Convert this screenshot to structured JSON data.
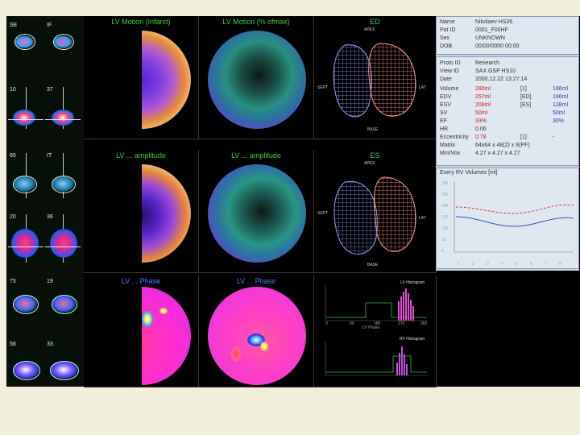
{
  "strip": {
    "labels": [
      "SE",
      "IF",
      "10",
      "37",
      "65",
      "IT",
      "20",
      "36",
      "75",
      "19",
      "56",
      "33"
    ]
  },
  "panels": {
    "lv_motion": "LV Motion (Infarct)",
    "lv_motion_rel": "LV Motion (% ofmax)",
    "mesh_top": "ED",
    "lv_amplitude": "LV ... amplitude",
    "lv_amplitude2": "LV ... amplitude",
    "mesh_bottom": "ES",
    "lv_phase": "LV ... Phase",
    "lv_phase2": "LV ... Phase",
    "hist_title_1": "LV Histogram",
    "hist_title_2": "RV Histogram",
    "mesh_labels": {
      "top": "APEX",
      "left": "SEPT",
      "right": "LAT",
      "bottom": "BASE"
    },
    "hist_axis_ticks": [
      "0",
      "90",
      "180",
      "270",
      "360"
    ],
    "hist_axis_label": "LV Phase"
  },
  "info": {
    "patient": [
      {
        "k": "Name",
        "v": "Nikolaev HS36"
      },
      {
        "k": "Pat ID",
        "v": "0001_F00HF"
      },
      {
        "k": "Sex",
        "v": "UNKNOWN"
      },
      {
        "k": "DOB",
        "v": "00/00/0000 00:00"
      }
    ],
    "study": [
      {
        "k": "Proto ID",
        "v": "Research"
      },
      {
        "k": "View ID",
        "v": "SAX GSP HS10"
      },
      {
        "k": "Date",
        "v": "2000.12.22 13:27:14"
      }
    ],
    "volumes": [
      {
        "k": "Volume",
        "v": "280ml",
        "u": "[1]",
        "w": "186ml"
      },
      {
        "k": "EDV",
        "v": "257ml",
        "u": "[ED]",
        "w": "186ml"
      },
      {
        "k": "ESV",
        "v": "208ml",
        "u": "[ES]",
        "w": "138ml"
      },
      {
        "k": "SV",
        "v": "50ml",
        "u": "",
        "w": "50ml"
      },
      {
        "k": "EF",
        "v": "33%",
        "u": "",
        "w": "30%"
      },
      {
        "k": "HR",
        "v": "0.06",
        "u": "",
        "w": ""
      },
      {
        "k": "Eccentricity",
        "v": "0.78",
        "u": "[1]",
        "w": "-"
      },
      {
        "k": "Matrix",
        "v": "64x64 x 48(2) x 8(PF)",
        "u": "",
        "w": ""
      },
      {
        "k": "Mm/Vox",
        "v": "4.27 x 4.27 x 4.27",
        "u": "",
        "w": ""
      }
    ],
    "graph_title": "Every RV Volumes [ml]",
    "graph_y": [
      "300",
      "250",
      "200",
      "150",
      "100",
      "50",
      "0"
    ],
    "graph_x": [
      "1",
      "2",
      "3",
      "4",
      "5",
      "6",
      "7",
      "8"
    ]
  },
  "colors": {
    "accent_green": "#39d13a",
    "accent_blue": "#4d7dff",
    "ed_mesh": "#8f9bff",
    "es_mesh": "#ff9a8c",
    "ed_curve": "#d23b3b",
    "es_curve": "#3552c8"
  }
}
